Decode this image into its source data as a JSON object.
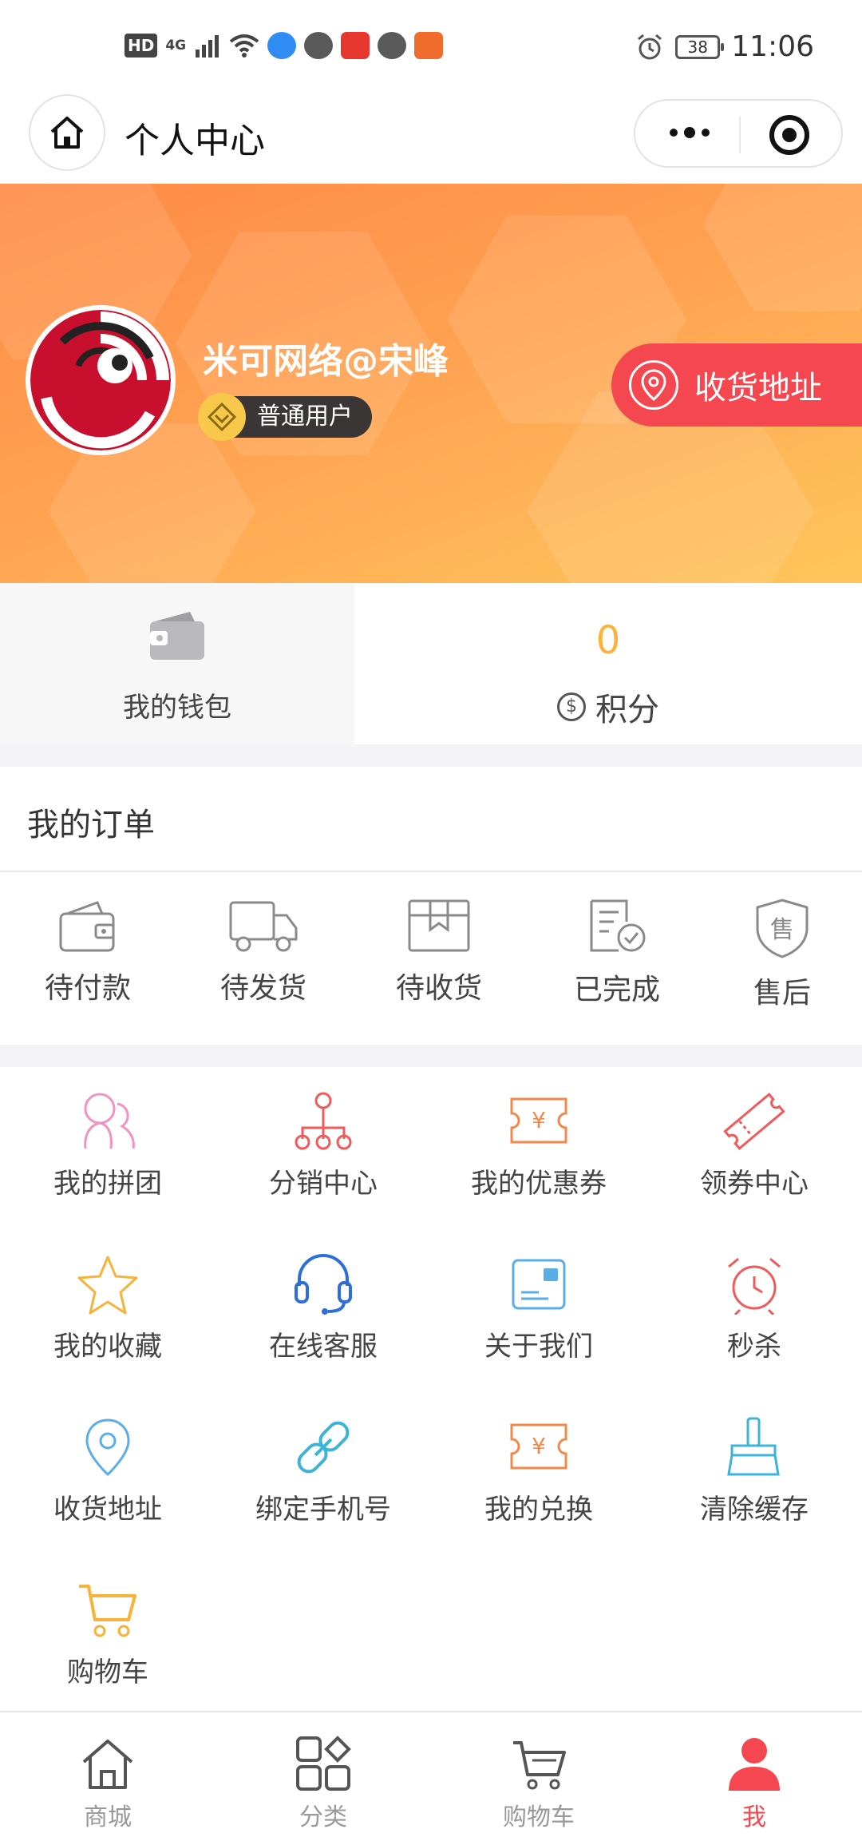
{
  "status_bar": {
    "network": "HD",
    "signal": "4G",
    "battery": "38",
    "time": "11:06",
    "app_colors": [
      "#2f8cf3",
      "#5a5a5a",
      "#e7372f",
      "#5a5a5a",
      "#f06c2c"
    ]
  },
  "nav": {
    "title": "个人中心"
  },
  "profile": {
    "name": "米可网络@宋峰",
    "level": "普通用户",
    "address_button": "收货地址"
  },
  "stats": {
    "wallet_label": "我的钱包",
    "points_value": "0",
    "points_label": "积分"
  },
  "orders": {
    "title": "我的订单",
    "items": [
      {
        "label": "待付款",
        "icon": "wallet-icon"
      },
      {
        "label": "待发货",
        "icon": "truck-icon"
      },
      {
        "label": "待收货",
        "icon": "package-icon"
      },
      {
        "label": "已完成",
        "icon": "document-check-icon"
      },
      {
        "label": "售后",
        "icon": "shield-after-sales-icon"
      }
    ]
  },
  "services": [
    {
      "label": "我的拼团",
      "icon": "group-buy-icon",
      "color": "#f291c2"
    },
    {
      "label": "分销中心",
      "icon": "network-icon",
      "color": "#f05a5a"
    },
    {
      "label": "我的优惠券",
      "icon": "coupon-icon",
      "color": "#f2894a"
    },
    {
      "label": "领券中心",
      "icon": "ticket-icon",
      "color": "#f05a5a"
    },
    {
      "label": "我的收藏",
      "icon": "star-icon",
      "color": "#f7b23a"
    },
    {
      "label": "在线客服",
      "icon": "headset-icon",
      "color": "#2d6fd8"
    },
    {
      "label": "关于我们",
      "icon": "card-icon",
      "color": "#5aaee8"
    },
    {
      "label": "秒杀",
      "icon": "alarm-clock-icon",
      "color": "#f05a5a"
    },
    {
      "label": "收货地址",
      "icon": "location-pin-icon",
      "color": "#5aaee8"
    },
    {
      "label": "绑定手机号",
      "icon": "link-icon",
      "color": "#3ab5d8"
    },
    {
      "label": "我的兑换",
      "icon": "exchange-voucher-icon",
      "color": "#f2894a"
    },
    {
      "label": "清除缓存",
      "icon": "broom-icon",
      "color": "#3ab5d8"
    },
    {
      "label": "购物车",
      "icon": "cart-icon",
      "color": "#f7b23a"
    }
  ],
  "tabs": [
    {
      "label": "商城",
      "icon": "home-icon",
      "active": false
    },
    {
      "label": "分类",
      "icon": "category-icon",
      "active": false
    },
    {
      "label": "购物车",
      "icon": "cart-icon",
      "active": false
    },
    {
      "label": "我",
      "icon": "user-icon",
      "active": true
    }
  ],
  "colors": {
    "accent": "#f4474f",
    "points": "#ffb23a",
    "banner_start": "#ff8a45",
    "banner_end": "#ffc65a"
  }
}
